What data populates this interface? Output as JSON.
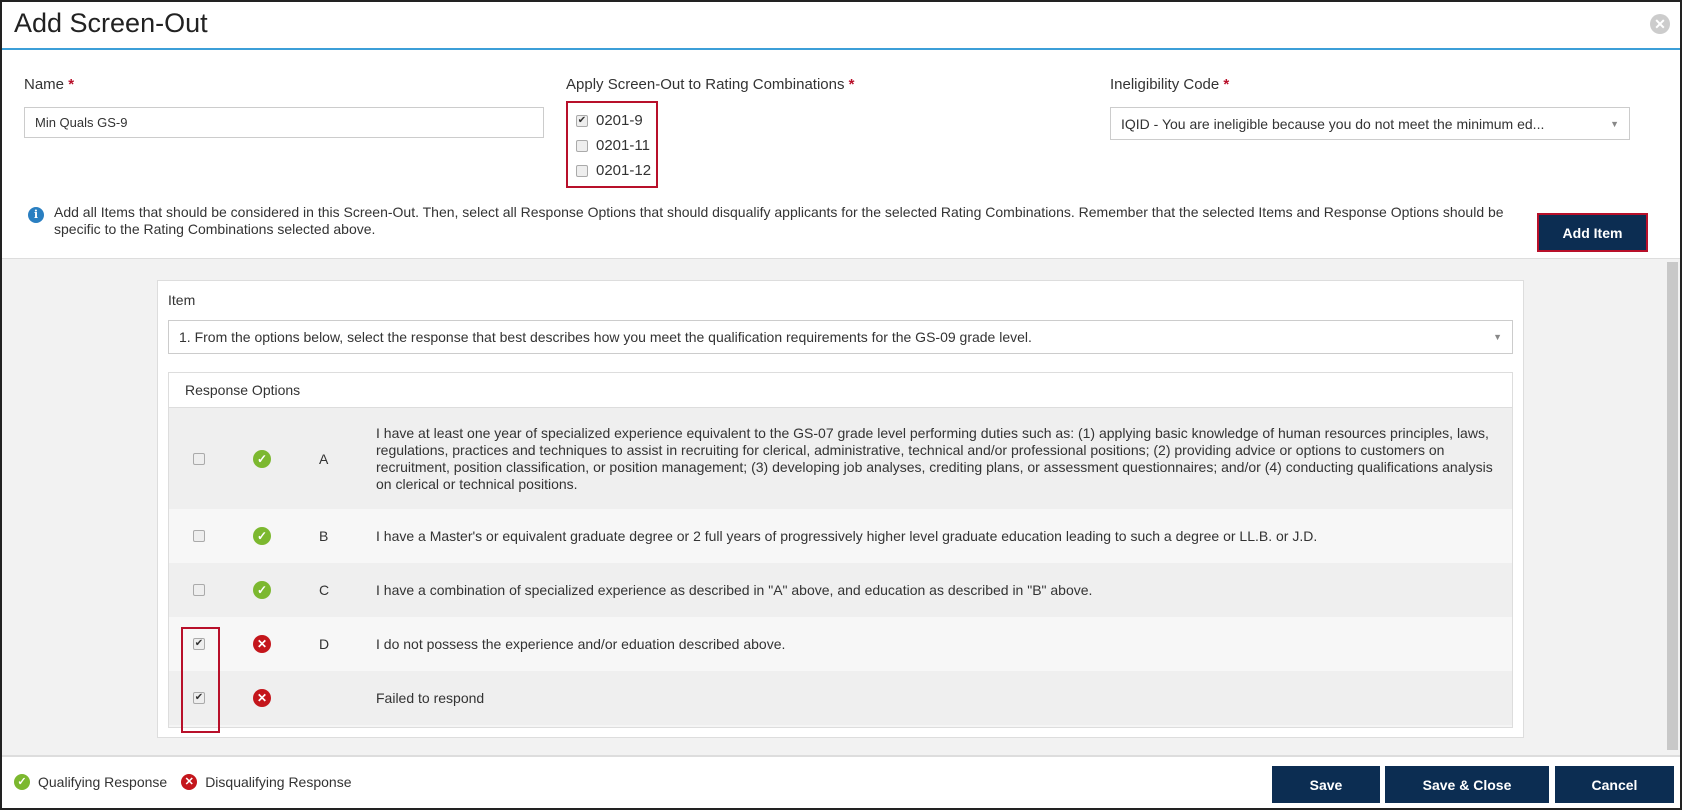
{
  "dialog": {
    "title": "Add Screen-Out"
  },
  "name_field": {
    "label": "Name",
    "value": "Min Quals GS-9"
  },
  "rating": {
    "label": "Apply Screen-Out to Rating Combinations",
    "options": [
      {
        "label": "0201-9",
        "checked": true
      },
      {
        "label": "0201-11",
        "checked": false
      },
      {
        "label": "0201-12",
        "checked": false
      }
    ]
  },
  "ineligibility": {
    "label": "Ineligibility Code",
    "value": "IQID - You are ineligible because you do not meet the minimum ed..."
  },
  "required_mark": "*",
  "info": "Add all Items that should be considered in this Screen-Out. Then, select all Response Options that should disqualify applicants for the selected Rating Combinations. Remember that the selected Items and Response Options should be specific to the Rating Combinations selected above.",
  "add_item_label": "Add Item",
  "item": {
    "label": "Item",
    "value": "1. From the options below, select the response that best describes how you meet the qualification requirements for the GS-09 grade level."
  },
  "responses": {
    "header": "Response Options",
    "rows": [
      {
        "checked": false,
        "status": "qualifying",
        "letter": "A",
        "text": "I have at least one year of specialized experience equivalent to the GS-07 grade level performing duties such as: (1) applying basic knowledge of human resources principles, laws, regulations, practices and techniques to assist in recruiting for clerical, administrative, technical and/or professional positions; (2) providing advice or options to customers on recruitment, position classification, or position management; (3) developing job analyses, crediting plans, or assessment questionnaires; and/or (4) conducting qualifications analysis on clerical or technical positions."
      },
      {
        "checked": false,
        "status": "qualifying",
        "letter": "B",
        "text": "I have a Master's or equivalent graduate degree or 2 full years of progressively higher level graduate education leading to such a degree or LL.B. or J.D."
      },
      {
        "checked": false,
        "status": "qualifying",
        "letter": "C",
        "text": "I have a combination of specialized experience as described in \"A\" above, and education as described in \"B\" above."
      },
      {
        "checked": true,
        "status": "disqualifying",
        "letter": "D",
        "text": "I do not possess the experience and/or eduation described above."
      },
      {
        "checked": true,
        "status": "disqualifying",
        "letter": "",
        "text": "Failed to respond"
      }
    ]
  },
  "legend": {
    "qualifying": "Qualifying Response",
    "disqualifying": "Disqualifying Response"
  },
  "footer": {
    "save": "Save",
    "save_close": "Save & Close",
    "cancel": "Cancel"
  },
  "colors": {
    "primary": "#0c2d52",
    "accent": "#3c9fd8",
    "highlight": "#b8102a",
    "ok": "#7cb82f",
    "bad": "#c4161c"
  }
}
